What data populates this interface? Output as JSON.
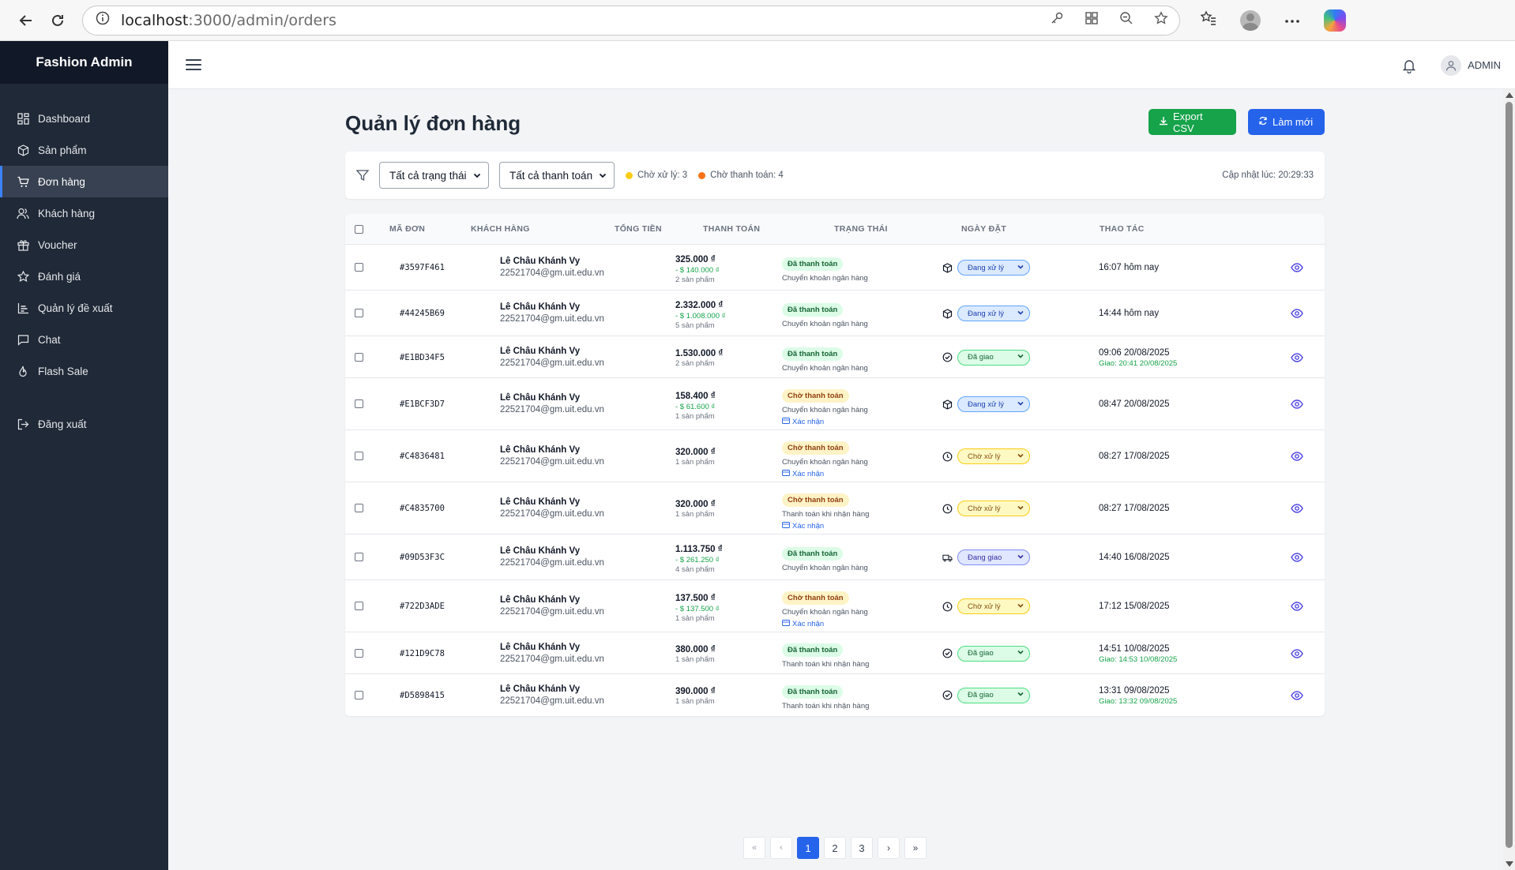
{
  "browser": {
    "url_host": "localhost",
    "url_path": ":3000/admin/orders"
  },
  "sidebar": {
    "brand": "Fashion Admin",
    "items": [
      {
        "label": "Dashboard",
        "icon": "grid-icon"
      },
      {
        "label": "Sản phẩm",
        "icon": "box-icon"
      },
      {
        "label": "Đơn hàng",
        "icon": "cart-icon",
        "active": true
      },
      {
        "label": "Khách hàng",
        "icon": "users-icon"
      },
      {
        "label": "Voucher",
        "icon": "gift-icon"
      },
      {
        "label": "Đánh giá",
        "icon": "star-icon"
      },
      {
        "label": "Quản lý đề xuất",
        "icon": "chart-icon"
      },
      {
        "label": "Chat",
        "icon": "chat-icon"
      },
      {
        "label": "Flash Sale",
        "icon": "flame-icon"
      }
    ],
    "logout": "Đăng xuất"
  },
  "header": {
    "admin_name": "ADMIN"
  },
  "page": {
    "title": "Quản lý đơn hàng",
    "export_label": "Export CSV",
    "refresh_label": "Làm mới"
  },
  "filters": {
    "status_select": "Tất cả trạng thái",
    "payment_select": "Tất cả thanh toán",
    "pending_processing": "Chờ xử lý: 3",
    "pending_payment": "Chờ thanh toán: 4",
    "updated": "Cập nhật lúc: 20:29:33",
    "colors": {
      "processing_dot": "#facc15",
      "payment_dot": "#f97316"
    }
  },
  "table": {
    "headers": {
      "code": "MÃ ĐƠN",
      "customer": "KHÁCH HÀNG",
      "total": "TỔNG TIỀN",
      "payment": "THANH TOÁN",
      "status": "TRẠNG THÁI",
      "date": "NGÀY ĐẶT",
      "actions": "THAO TÁC"
    },
    "rows": [
      {
        "code": "#3597F461",
        "name": "Lê Châu Khánh Vy",
        "email": "22521704@gm.uit.edu.vn",
        "amount": "325.000 ₫",
        "discount": "- $ 140.000 ₫",
        "qty": "2 sản phẩm",
        "pay_badge": "Đã thanh toán",
        "pay_type": "paid",
        "method": "Chuyển khoản ngân hàng",
        "confirm": "",
        "status": "Đang xử lý",
        "status_type": "proc",
        "status_icon": "package-icon",
        "date": "16:07 hôm nay",
        "delivered": ""
      },
      {
        "code": "#44245B69",
        "name": "Lê Châu Khánh Vy",
        "email": "22521704@gm.uit.edu.vn",
        "amount": "2.332.000 ₫",
        "discount": "- $ 1.008.000 ₫",
        "qty": "5 sản phẩm",
        "pay_badge": "Đã thanh toán",
        "pay_type": "paid",
        "method": "Chuyển khoản ngân hàng",
        "confirm": "",
        "status": "Đang xử lý",
        "status_type": "proc",
        "status_icon": "package-icon",
        "date": "14:44 hôm nay",
        "delivered": ""
      },
      {
        "code": "#E1BD34F5",
        "name": "Lê Châu Khánh Vy",
        "email": "22521704@gm.uit.edu.vn",
        "amount": "1.530.000 ₫",
        "discount": "",
        "qty": "2 sản phẩm",
        "pay_badge": "Đã thanh toán",
        "pay_type": "paid",
        "method": "Chuyển khoản ngân hàng",
        "confirm": "",
        "status": "Đã giao",
        "status_type": "done",
        "status_icon": "check-circle-icon",
        "date": "09:06 20/08/2025",
        "delivered": "Giao: 20:41 20/08/2025"
      },
      {
        "code": "#E1BCF3D7",
        "name": "Lê Châu Khánh Vy",
        "email": "22521704@gm.uit.edu.vn",
        "amount": "158.400 ₫",
        "discount": "- $ 61.600 ₫",
        "qty": "1 sản phẩm",
        "pay_badge": "Chờ thanh toán",
        "pay_type": "wait",
        "method": "Chuyển khoản ngân hàng",
        "confirm": "Xác nhận",
        "status": "Đang xử lý",
        "status_type": "proc",
        "status_icon": "package-icon",
        "date": "08:47 20/08/2025",
        "delivered": ""
      },
      {
        "code": "#C4836481",
        "name": "Lê Châu Khánh Vy",
        "email": "22521704@gm.uit.edu.vn",
        "amount": "320.000 ₫",
        "discount": "",
        "qty": "1 sản phẩm",
        "pay_badge": "Chờ thanh toán",
        "pay_type": "wait",
        "method": "Chuyển khoản ngân hàng",
        "confirm": "Xác nhận",
        "status": "Chờ xử lý",
        "status_type": "pend",
        "status_icon": "clock-icon",
        "date": "08:27 17/08/2025",
        "delivered": ""
      },
      {
        "code": "#C4835700",
        "name": "Lê Châu Khánh Vy",
        "email": "22521704@gm.uit.edu.vn",
        "amount": "320.000 ₫",
        "discount": "",
        "qty": "1 sản phẩm",
        "pay_badge": "Chờ thanh toán",
        "pay_type": "wait",
        "method": "Thanh toán khi nhận hàng",
        "confirm": "Xác nhận",
        "status": "Chờ xử lý",
        "status_type": "pend",
        "status_icon": "clock-icon",
        "date": "08:27 17/08/2025",
        "delivered": ""
      },
      {
        "code": "#09D53F3C",
        "name": "Lê Châu Khánh Vy",
        "email": "22521704@gm.uit.edu.vn",
        "amount": "1.113.750 ₫",
        "discount": "- $ 261.250 ₫",
        "qty": "4 sản phẩm",
        "pay_badge": "Đã thanh toán",
        "pay_type": "paid",
        "method": "Chuyển khoản ngân hàng",
        "confirm": "",
        "status": "Đang giao",
        "status_type": "ship",
        "status_icon": "truck-icon",
        "date": "14:40 16/08/2025",
        "delivered": ""
      },
      {
        "code": "#722D3ADE",
        "name": "Lê Châu Khánh Vy",
        "email": "22521704@gm.uit.edu.vn",
        "amount": "137.500 ₫",
        "discount": "- $ 137.500 ₫",
        "qty": "1 sản phẩm",
        "pay_badge": "Chờ thanh toán",
        "pay_type": "wait",
        "method": "Chuyển khoản ngân hàng",
        "confirm": "Xác nhận",
        "status": "Chờ xử lý",
        "status_type": "pend",
        "status_icon": "clock-icon",
        "date": "17:12 15/08/2025",
        "delivered": ""
      },
      {
        "code": "#121D9C78",
        "name": "Lê Châu Khánh Vy",
        "email": "22521704@gm.uit.edu.vn",
        "amount": "380.000 ₫",
        "discount": "",
        "qty": "1 sản phẩm",
        "pay_badge": "Đã thanh toán",
        "pay_type": "paid",
        "method": "Thanh toán khi nhận hàng",
        "confirm": "",
        "status": "Đã giao",
        "status_type": "done",
        "status_icon": "check-circle-icon",
        "date": "14:51 10/08/2025",
        "delivered": "Giao: 14:53 10/08/2025"
      },
      {
        "code": "#D5898415",
        "name": "Lê Châu Khánh Vy",
        "email": "22521704@gm.uit.edu.vn",
        "amount": "390.000 ₫",
        "discount": "",
        "qty": "1 sản phẩm",
        "pay_badge": "Đã thanh toán",
        "pay_type": "paid",
        "method": "Thanh toán khi nhận hàng",
        "confirm": "",
        "status": "Đã giao",
        "status_type": "done",
        "status_icon": "check-circle-icon",
        "date": "13:31 09/08/2025",
        "delivered": "Giao: 13:32 09/08/2025"
      }
    ]
  },
  "pagination": {
    "first": "«",
    "prev": "‹",
    "pages": [
      "1",
      "2",
      "3"
    ],
    "current": "1",
    "next": "›",
    "last": "»"
  }
}
